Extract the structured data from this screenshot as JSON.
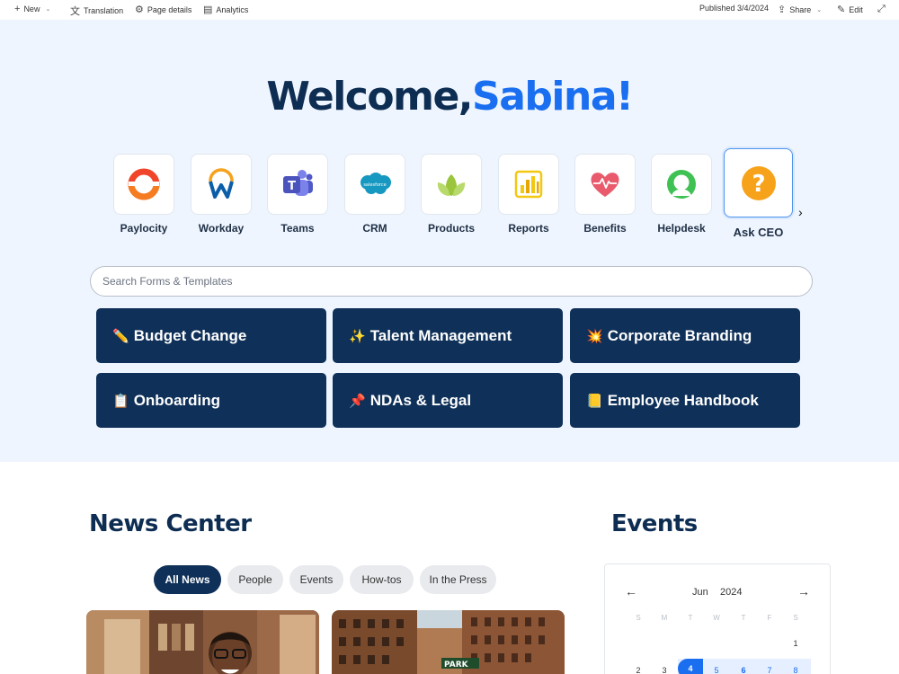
{
  "commandbar": {
    "new_label": "New",
    "translation_label": "Translation",
    "page_details_label": "Page details",
    "analytics_label": "Analytics",
    "published_label": "Published 3/4/2024",
    "share_label": "Share",
    "edit_label": "Edit"
  },
  "hero": {
    "welcome_prefix": "Welcome,",
    "welcome_name": "Sabina!",
    "apps": [
      {
        "label": "Paylocity",
        "icon": "paylocity-icon"
      },
      {
        "label": "Workday",
        "icon": "workday-icon"
      },
      {
        "label": "Teams",
        "icon": "teams-icon"
      },
      {
        "label": "CRM",
        "icon": "salesforce-icon"
      },
      {
        "label": "Products",
        "icon": "leaf-icon"
      },
      {
        "label": "Reports",
        "icon": "powerbi-icon"
      },
      {
        "label": "Benefits",
        "icon": "heart-icon"
      },
      {
        "label": "Helpdesk",
        "icon": "helpdesk-icon"
      },
      {
        "label": "Ask CEO",
        "icon": "question-icon"
      }
    ],
    "search_placeholder": "Search Forms & Templates",
    "salesforce_text": "salesforce",
    "quick_links": [
      {
        "emoji": "✏️",
        "label": "Budget Change"
      },
      {
        "emoji": "✨",
        "label": "Talent Management"
      },
      {
        "emoji": "💥",
        "label": "Corporate Branding"
      },
      {
        "emoji": "📋",
        "label": "Onboarding"
      },
      {
        "emoji": "📌",
        "label": "NDAs & Legal"
      },
      {
        "emoji": "📒",
        "label": "Employee Handbook"
      }
    ]
  },
  "news": {
    "title": "News Center",
    "filters": [
      "All News",
      "People",
      "Events",
      "How-tos",
      "In the Press"
    ],
    "active_filter": "All News",
    "sign_text": "PARK"
  },
  "events": {
    "title": "Events",
    "month": "Jun",
    "year": "2024",
    "weekdays": [
      "S",
      "M",
      "T",
      "W",
      "T",
      "F",
      "S"
    ],
    "week1": [
      "1"
    ],
    "week2": [
      "2",
      "3",
      "4",
      "5",
      "6",
      "7",
      "8"
    ],
    "selected_day": "4",
    "colors": {
      "accent": "#1a6ef0",
      "navy": "#0f3058"
    }
  }
}
